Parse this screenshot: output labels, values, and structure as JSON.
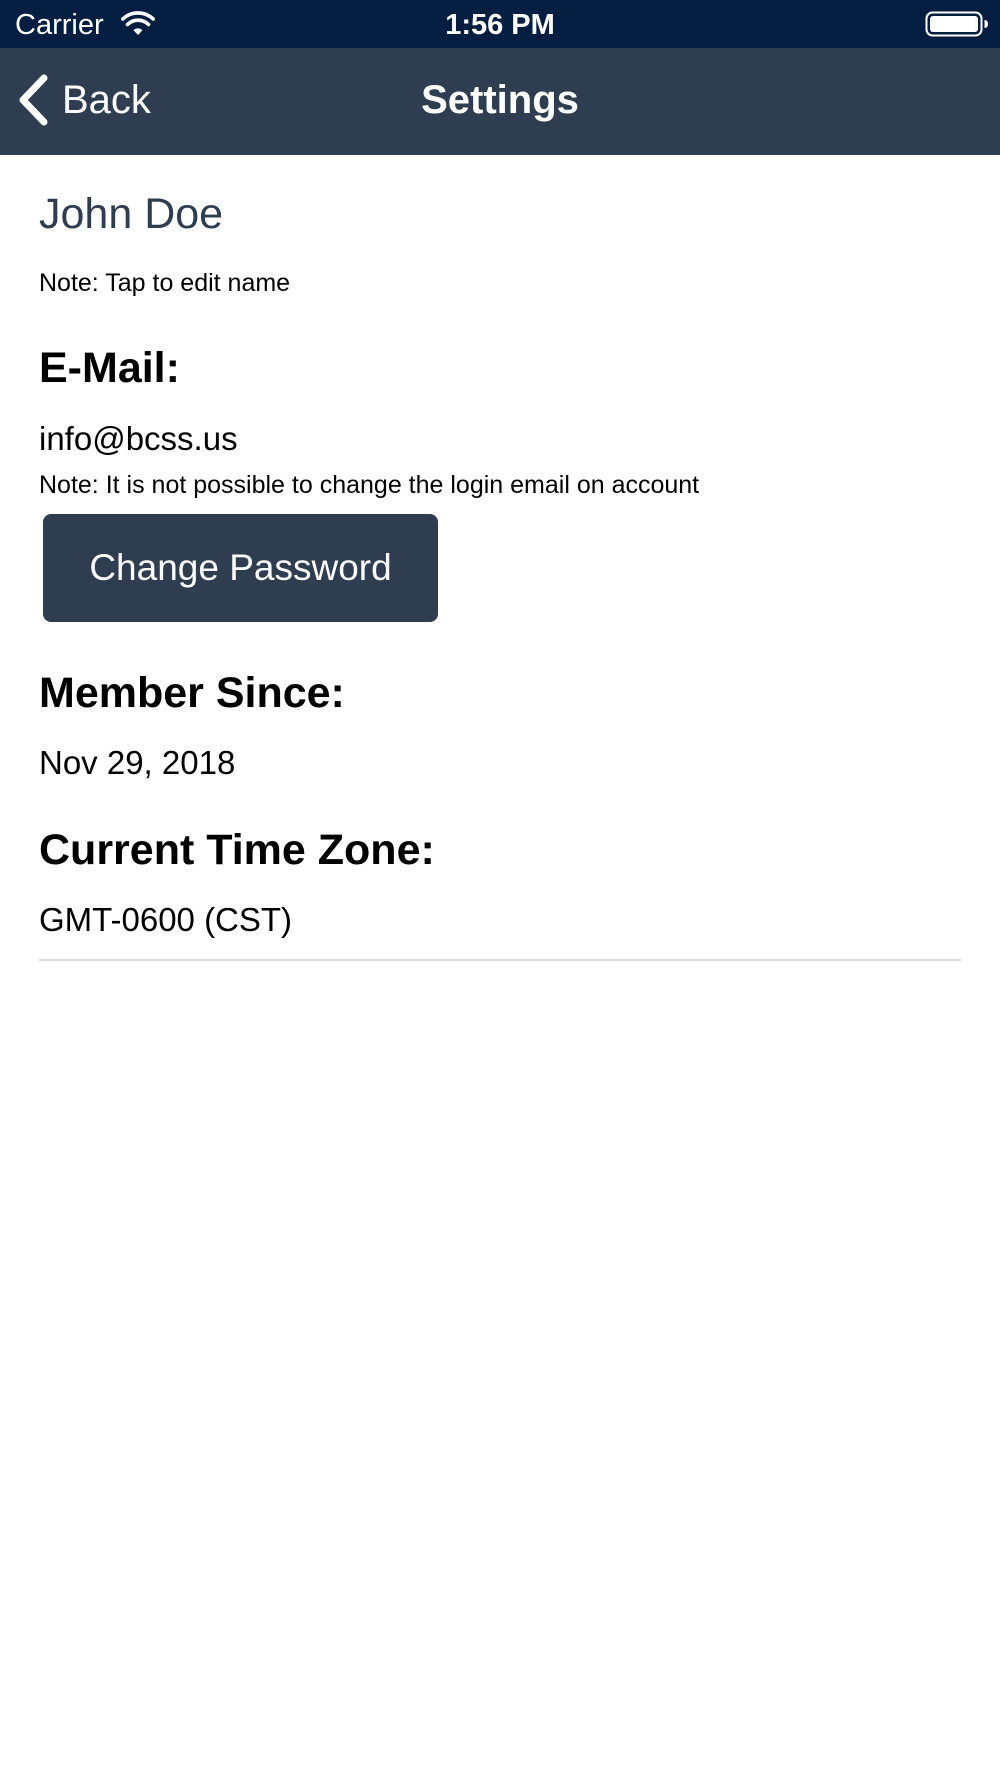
{
  "status_bar": {
    "carrier": "Carrier",
    "time": "1:56 PM",
    "wifi_icon": "wifi-icon",
    "battery_icon": "battery-full-icon"
  },
  "nav_bar": {
    "back_label": "Back",
    "back_icon": "chevron-left-icon",
    "title": "Settings",
    "background_color": "#2e3d50"
  },
  "profile": {
    "name": "John Doe",
    "name_note": "Note: Tap to edit name",
    "email_heading": "E-Mail:",
    "email": "info@bcss.us",
    "email_note": "Note: It is not possible to change the login email on account",
    "change_password_label": "Change Password",
    "member_since_heading": "Member Since:",
    "member_since": "Nov 29, 2018",
    "time_zone_heading": "Current Time Zone:",
    "time_zone": "GMT-0600 (CST)"
  },
  "colors": {
    "status_bar": "#041e42",
    "accent": "#2e3d50",
    "text": "#000000"
  }
}
